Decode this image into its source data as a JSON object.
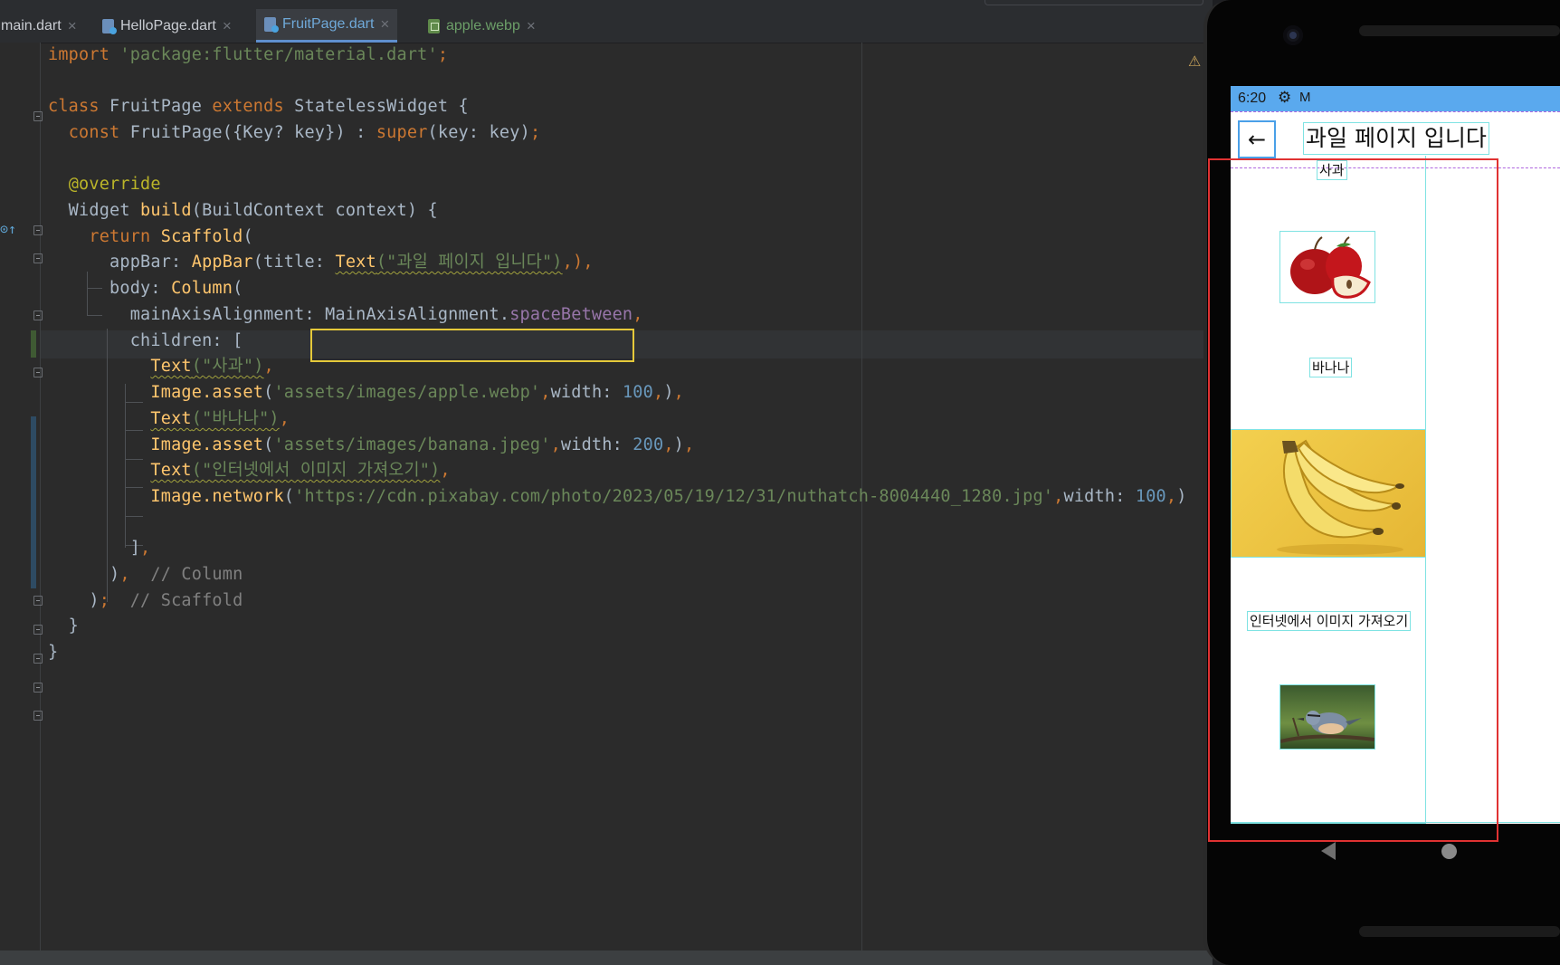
{
  "tabs": [
    {
      "label": "main.dart",
      "icon": "dart-file-icon",
      "active": false
    },
    {
      "label": "HelloPage.dart",
      "icon": "dart-file-icon",
      "active": false
    },
    {
      "label": "FruitPage.dart",
      "icon": "dart-file-icon",
      "active": true
    },
    {
      "label": "apple.webp",
      "icon": "image-file-icon",
      "active": false
    }
  ],
  "editor": {
    "lines": [
      {
        "tokens": [
          [
            "kw",
            "import "
          ],
          [
            "str",
            "'package:flutter/material.dart'"
          ],
          [
            "kw",
            ";"
          ]
        ]
      },
      {
        "tokens": []
      },
      {
        "tokens": [
          [
            "kw",
            "class "
          ],
          [
            "plain",
            "FruitPage "
          ],
          [
            "kw",
            "extends "
          ],
          [
            "plain",
            "StatelessWidget {"
          ]
        ]
      },
      {
        "tokens": [
          [
            "plain",
            "  "
          ],
          [
            "kw",
            "const "
          ],
          [
            "plain",
            "FruitPage({Key? key}) : "
          ],
          [
            "kw",
            "super"
          ],
          [
            "plain",
            "(key: key)"
          ],
          [
            "kw",
            ";"
          ]
        ]
      },
      {
        "tokens": []
      },
      {
        "tokens": [
          [
            "plain",
            "  "
          ],
          [
            "ann",
            "@override"
          ]
        ]
      },
      {
        "tokens": [
          [
            "plain",
            "  Widget "
          ],
          [
            "cls",
            "build"
          ],
          [
            "plain",
            "(BuildContext context) {"
          ]
        ]
      },
      {
        "tokens": [
          [
            "plain",
            "    "
          ],
          [
            "kw",
            "return "
          ],
          [
            "cls",
            "Scaffold"
          ],
          [
            "plain",
            "("
          ]
        ]
      },
      {
        "tokens": [
          [
            "plain",
            "      appBar: "
          ],
          [
            "cls",
            "AppBar"
          ],
          [
            "plain",
            "(title: "
          ],
          [
            "squig-cls",
            "Text"
          ],
          [
            "squig-str",
            "(\"과일 페이지 입니다\")"
          ],
          [
            "kw",
            ",)"
          ],
          [
            "kw",
            ","
          ]
        ]
      },
      {
        "tokens": [
          [
            "plain",
            "      body: "
          ],
          [
            "cls",
            "Column"
          ],
          [
            "plain",
            "("
          ]
        ]
      },
      {
        "tokens": [
          [
            "plain",
            "        mainAxisAlignment: "
          ],
          [
            "plain",
            "MainAxisAlignment."
          ],
          [
            "prop",
            "spaceBetween"
          ],
          [
            "kw",
            ","
          ]
        ]
      },
      {
        "tokens": [
          [
            "plain",
            "        children: ["
          ]
        ]
      },
      {
        "tokens": [
          [
            "plain",
            "          "
          ],
          [
            "squig-cls",
            "Text"
          ],
          [
            "squig-str",
            "(\"사과\")"
          ],
          [
            "kw",
            ","
          ]
        ]
      },
      {
        "tokens": [
          [
            "plain",
            "          "
          ],
          [
            "cls",
            "Image.asset"
          ],
          [
            "plain",
            "("
          ],
          [
            "str",
            "'assets/images/apple.webp'"
          ],
          [
            "kw",
            ","
          ],
          [
            "plain",
            "width: "
          ],
          [
            "num",
            "100"
          ],
          [
            "kw",
            ","
          ],
          [
            "plain",
            ")"
          ],
          [
            "kw",
            ","
          ]
        ]
      },
      {
        "tokens": [
          [
            "plain",
            "          "
          ],
          [
            "squig-cls",
            "Text"
          ],
          [
            "squig-str",
            "(\"바나나\")"
          ],
          [
            "kw",
            ","
          ]
        ]
      },
      {
        "tokens": [
          [
            "plain",
            "          "
          ],
          [
            "cls",
            "Image.asset"
          ],
          [
            "plain",
            "("
          ],
          [
            "str",
            "'assets/images/banana.jpeg'"
          ],
          [
            "kw",
            ","
          ],
          [
            "plain",
            "width: "
          ],
          [
            "num",
            "200"
          ],
          [
            "kw",
            ","
          ],
          [
            "plain",
            ")"
          ],
          [
            "kw",
            ","
          ]
        ]
      },
      {
        "tokens": [
          [
            "plain",
            "          "
          ],
          [
            "squig-cls",
            "Text"
          ],
          [
            "squig-str",
            "(\"인터넷에서 이미지 가져오기\")"
          ],
          [
            "kw",
            ","
          ]
        ]
      },
      {
        "tokens": [
          [
            "plain",
            "          "
          ],
          [
            "cls",
            "Image.network"
          ],
          [
            "plain",
            "("
          ],
          [
            "str",
            "'https://cdn.pixabay.com/photo/2023/05/19/12/31/nuthatch-8004440_1280.jpg'"
          ],
          [
            "kw",
            ","
          ],
          [
            "plain",
            "width: "
          ],
          [
            "num",
            "100"
          ],
          [
            "kw",
            ","
          ],
          [
            "plain",
            ")"
          ]
        ]
      },
      {
        "tokens": []
      },
      {
        "tokens": [
          [
            "plain",
            "        ]"
          ],
          [
            "kw",
            ","
          ]
        ]
      },
      {
        "tokens": [
          [
            "plain",
            "      )"
          ],
          [
            "kw",
            ",  "
          ],
          [
            "cmt",
            "// Column"
          ]
        ]
      },
      {
        "tokens": [
          [
            "plain",
            "    )"
          ],
          [
            "kw",
            ";  "
          ],
          [
            "cmt",
            "// Scaffold"
          ]
        ]
      },
      {
        "tokens": [
          [
            "plain",
            "  }"
          ]
        ]
      },
      {
        "tokens": [
          [
            "plain",
            "}"
          ]
        ]
      }
    ]
  },
  "phone": {
    "status_time": "6:20",
    "status_icons": [
      "gear-icon",
      "gmail-icon"
    ],
    "appbar_title": "과일 페이지 입니다",
    "back_icon": "arrow-back-icon",
    "labels": {
      "apple": "사과",
      "banana": "바나나",
      "internet": "인터넷에서 이미지 가져오기"
    },
    "images": [
      "apple-image",
      "banana-image",
      "nuthatch-image"
    ]
  },
  "colors": {
    "highlight_box": "#e5c93a",
    "device_outline": "#e03232",
    "statusbar": "#5aa9ee",
    "debug_guides": "#7fe3e3"
  }
}
